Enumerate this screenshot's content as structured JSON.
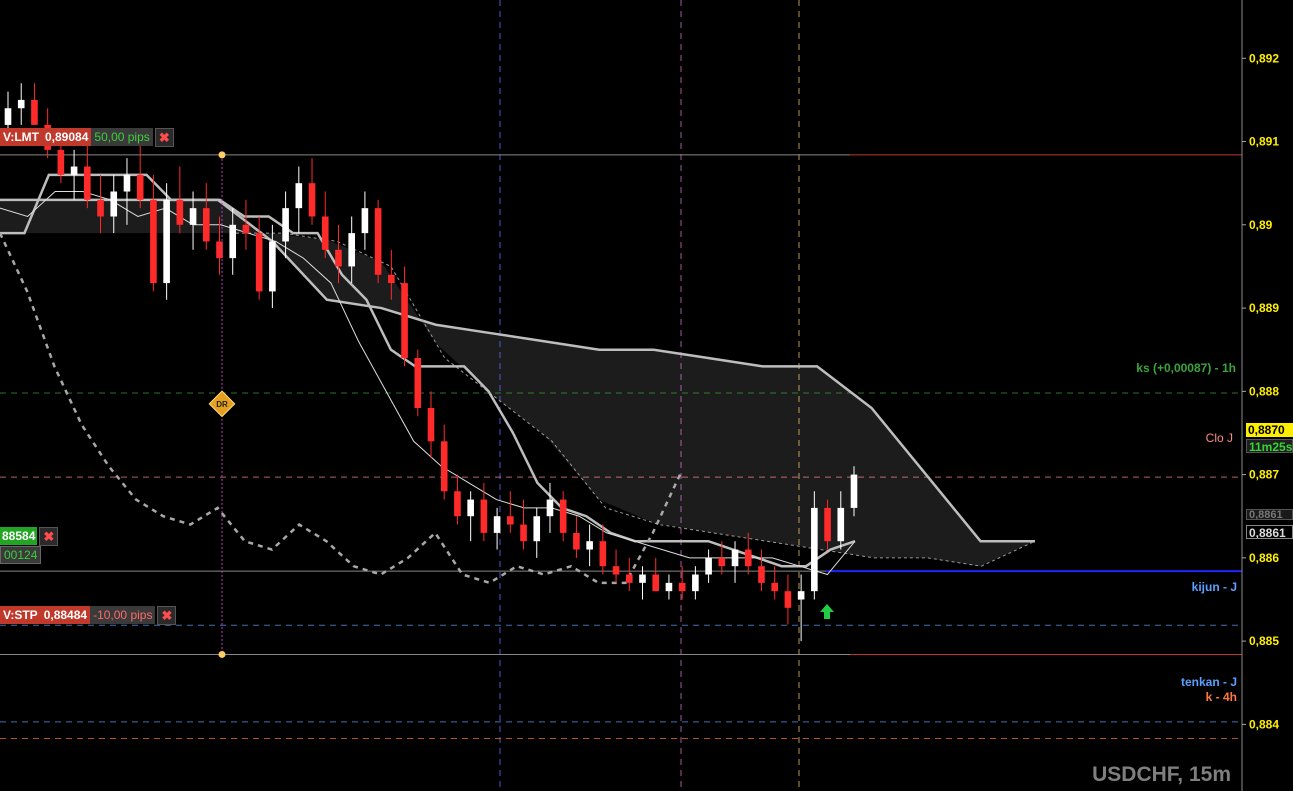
{
  "chart_data": {
    "type": "candlestick",
    "title": "USDCHF, 15m",
    "xlabel": "",
    "ylabel": "",
    "ylim": [
      0.8832,
      0.8927
    ],
    "y_ticks": [
      "0,892",
      "0,891",
      "0,89",
      "0,889",
      "0,888",
      "0,887",
      "0,886",
      "0,885",
      "0,884"
    ],
    "grid": false,
    "candles": [
      [
        0.8912,
        0.8916,
        0.891,
        0.8914
      ],
      [
        0.8914,
        0.8917,
        0.8912,
        0.8915
      ],
      [
        0.8915,
        0.8917,
        0.8913,
        0.8912
      ],
      [
        0.8912,
        0.8914,
        0.8908,
        0.8909
      ],
      [
        0.8909,
        0.8911,
        0.8905,
        0.8906
      ],
      [
        0.8906,
        0.8909,
        0.8903,
        0.8907
      ],
      [
        0.8907,
        0.891,
        0.8902,
        0.8903
      ],
      [
        0.8903,
        0.8906,
        0.8899,
        0.8901
      ],
      [
        0.8901,
        0.8906,
        0.8899,
        0.8904
      ],
      [
        0.8904,
        0.8908,
        0.89,
        0.8906
      ],
      [
        0.8906,
        0.891,
        0.8902,
        0.8903
      ],
      [
        0.8903,
        0.8906,
        0.8892,
        0.8893
      ],
      [
        0.8893,
        0.8905,
        0.8891,
        0.8903
      ],
      [
        0.8903,
        0.8907,
        0.8899,
        0.89
      ],
      [
        0.89,
        0.8904,
        0.8897,
        0.8902
      ],
      [
        0.8902,
        0.8905,
        0.8897,
        0.8898
      ],
      [
        0.8898,
        0.8901,
        0.8894,
        0.8896
      ],
      [
        0.8896,
        0.8902,
        0.8894,
        0.89
      ],
      [
        0.89,
        0.8903,
        0.8897,
        0.8899
      ],
      [
        0.8899,
        0.8901,
        0.8891,
        0.8892
      ],
      [
        0.8892,
        0.89,
        0.889,
        0.8898
      ],
      [
        0.8898,
        0.8904,
        0.8896,
        0.8902
      ],
      [
        0.8902,
        0.8907,
        0.8899,
        0.8905
      ],
      [
        0.8905,
        0.8908,
        0.89,
        0.8901
      ],
      [
        0.8901,
        0.8904,
        0.8896,
        0.8897
      ],
      [
        0.8897,
        0.89,
        0.8893,
        0.8895
      ],
      [
        0.8895,
        0.8901,
        0.8893,
        0.8899
      ],
      [
        0.8899,
        0.8904,
        0.8897,
        0.8902
      ],
      [
        0.8902,
        0.8903,
        0.8893,
        0.8894
      ],
      [
        0.8894,
        0.8897,
        0.8891,
        0.8893
      ],
      [
        0.8893,
        0.8895,
        0.8883,
        0.8884
      ],
      [
        0.8884,
        0.8885,
        0.8877,
        0.8878
      ],
      [
        0.8878,
        0.888,
        0.8872,
        0.8874
      ],
      [
        0.8874,
        0.8876,
        0.8867,
        0.8868
      ],
      [
        0.8868,
        0.887,
        0.8864,
        0.8865
      ],
      [
        0.8865,
        0.8868,
        0.8862,
        0.8867
      ],
      [
        0.8867,
        0.8869,
        0.8862,
        0.8863
      ],
      [
        0.8863,
        0.8866,
        0.8861,
        0.8865
      ],
      [
        0.8865,
        0.8868,
        0.8863,
        0.8864
      ],
      [
        0.8864,
        0.8867,
        0.8861,
        0.8862
      ],
      [
        0.8862,
        0.8866,
        0.886,
        0.8865
      ],
      [
        0.8865,
        0.8869,
        0.8863,
        0.8867
      ],
      [
        0.8867,
        0.8868,
        0.8862,
        0.8863
      ],
      [
        0.8863,
        0.8865,
        0.886,
        0.8861
      ],
      [
        0.8861,
        0.8864,
        0.8859,
        0.8862
      ],
      [
        0.8862,
        0.8864,
        0.8858,
        0.8859
      ],
      [
        0.8859,
        0.8861,
        0.8857,
        0.8858
      ],
      [
        0.8858,
        0.886,
        0.8856,
        0.8857
      ],
      [
        0.8857,
        0.8859,
        0.8855,
        0.8858
      ],
      [
        0.8858,
        0.886,
        0.8856,
        0.8856
      ],
      [
        0.8856,
        0.8858,
        0.8855,
        0.8857
      ],
      [
        0.8857,
        0.8859,
        0.8855,
        0.8856
      ],
      [
        0.8856,
        0.8859,
        0.8855,
        0.8858
      ],
      [
        0.8858,
        0.8861,
        0.8857,
        0.886
      ],
      [
        0.886,
        0.8862,
        0.8858,
        0.8859
      ],
      [
        0.8859,
        0.8862,
        0.8857,
        0.8861
      ],
      [
        0.8861,
        0.8863,
        0.8858,
        0.8859
      ],
      [
        0.8859,
        0.8861,
        0.8856,
        0.8857
      ],
      [
        0.8857,
        0.8859,
        0.8855,
        0.8856
      ],
      [
        0.8856,
        0.8858,
        0.8852,
        0.8854
      ],
      [
        0.8855,
        0.8858,
        0.885,
        0.8856
      ],
      [
        0.8856,
        0.8868,
        0.8855,
        0.8866
      ],
      [
        0.8866,
        0.8867,
        0.8861,
        0.8862
      ],
      [
        0.8862,
        0.8868,
        0.8861,
        0.8866
      ],
      [
        0.8866,
        0.8871,
        0.8865,
        0.887
      ]
    ],
    "series": [
      {
        "name": "",
        "style": "solid-thick",
        "values": [
          0.8899,
          0.8899,
          0.8906,
          0.8906,
          0.8906,
          0.8906,
          0.8906,
          0.8903,
          0.8903,
          0.8903,
          0.8901,
          0.8901,
          0.8899,
          0.8899,
          0.8894,
          0.8891,
          0.8885,
          0.8883,
          0.8883,
          0.8883,
          0.888,
          0.8875,
          0.8869,
          0.8866,
          0.8865,
          0.8863,
          0.8862,
          0.8862,
          0.8862,
          0.8862,
          0.8861,
          0.886,
          0.8859,
          0.8859,
          0.8861,
          0.8862
        ]
      },
      {
        "name": "",
        "style": "solid-thin",
        "values": [
          0.8902,
          0.8901,
          0.8904,
          0.8904,
          0.8903,
          0.8901,
          0.8902,
          0.89,
          0.89,
          0.8899,
          0.8898,
          0.8896,
          0.8893,
          0.8886,
          0.888,
          0.8874,
          0.8871,
          0.8869,
          0.8867,
          0.8866,
          0.8866,
          0.8865,
          0.8863,
          0.8862,
          0.8861,
          0.886,
          0.886,
          0.886,
          0.886,
          0.8859,
          0.8858,
          0.8862
        ]
      },
      {
        "name": "",
        "style": "dashed",
        "values": [
          0.8899,
          0.8892,
          0.8883,
          0.8876,
          0.8871,
          0.8867,
          0.8865,
          0.8864,
          0.8866,
          0.8862,
          0.8861,
          0.8864,
          0.8862,
          0.8859,
          0.8858,
          0.886,
          0.8863,
          0.8858,
          0.8857,
          0.8859,
          0.8858,
          0.8859,
          0.8857,
          0.8857,
          0.8863,
          0.887
        ]
      },
      {
        "name": "",
        "style": "cloud-upper",
        "values": [
          0.8903,
          0.8903,
          0.8903,
          0.8903,
          0.8903,
          0.8898,
          0.8891,
          0.889,
          0.8888,
          0.8887,
          0.8886,
          0.8885,
          0.8885,
          0.8884,
          0.8883,
          0.8883,
          0.8878,
          0.887,
          0.8862,
          0.8862
        ]
      },
      {
        "name": "",
        "style": "cloud-lower",
        "values": [
          0.8899,
          0.8899,
          0.8898,
          0.8895,
          0.8884,
          0.8879,
          0.8874,
          0.8866,
          0.8864,
          0.8863,
          0.8862,
          0.8861,
          0.886,
          0.886,
          0.8859,
          0.8862
        ]
      }
    ],
    "horizontal_levels": [
      {
        "label": "ks (+0,00087) - 1h",
        "value": 0.88798,
        "color": "#3aa53a"
      },
      {
        "label": "Clo J",
        "value": 0.88697,
        "color": "#ff8a8a"
      },
      {
        "label": "kijun - J",
        "value": 0.88519,
        "color": "#5aa0ff"
      },
      {
        "label": "tenkan - J",
        "value": 0.88403,
        "color": "#5aa0ff"
      },
      {
        "label": "k - 4h",
        "value": 0.88383,
        "color": "#ff7a3a"
      }
    ]
  },
  "orders": {
    "limit": {
      "type": "V:LMT",
      "price": "0,89084",
      "pips": "50,00 pips",
      "close": "✖"
    },
    "entry": {
      "price": "88584",
      "pips": "00124",
      "close": "✖"
    },
    "stop": {
      "type": "V:STP",
      "price": "0,88484",
      "pips": "-10,00 pips",
      "close": "✖"
    }
  },
  "axis": {
    "current_price": "0,8870",
    "countdown": "11m25s",
    "price_box_2": "0,8861",
    "price_box_3": "0,8861"
  },
  "markers": {
    "dr_label": "DR"
  },
  "colors": {
    "bull": "#ffffff",
    "bear": "#ff2a2a",
    "accent_yellow": "#ffee00",
    "order_red": "#c0392b",
    "order_green": "#22a522",
    "entry_line": "#2222ff"
  }
}
